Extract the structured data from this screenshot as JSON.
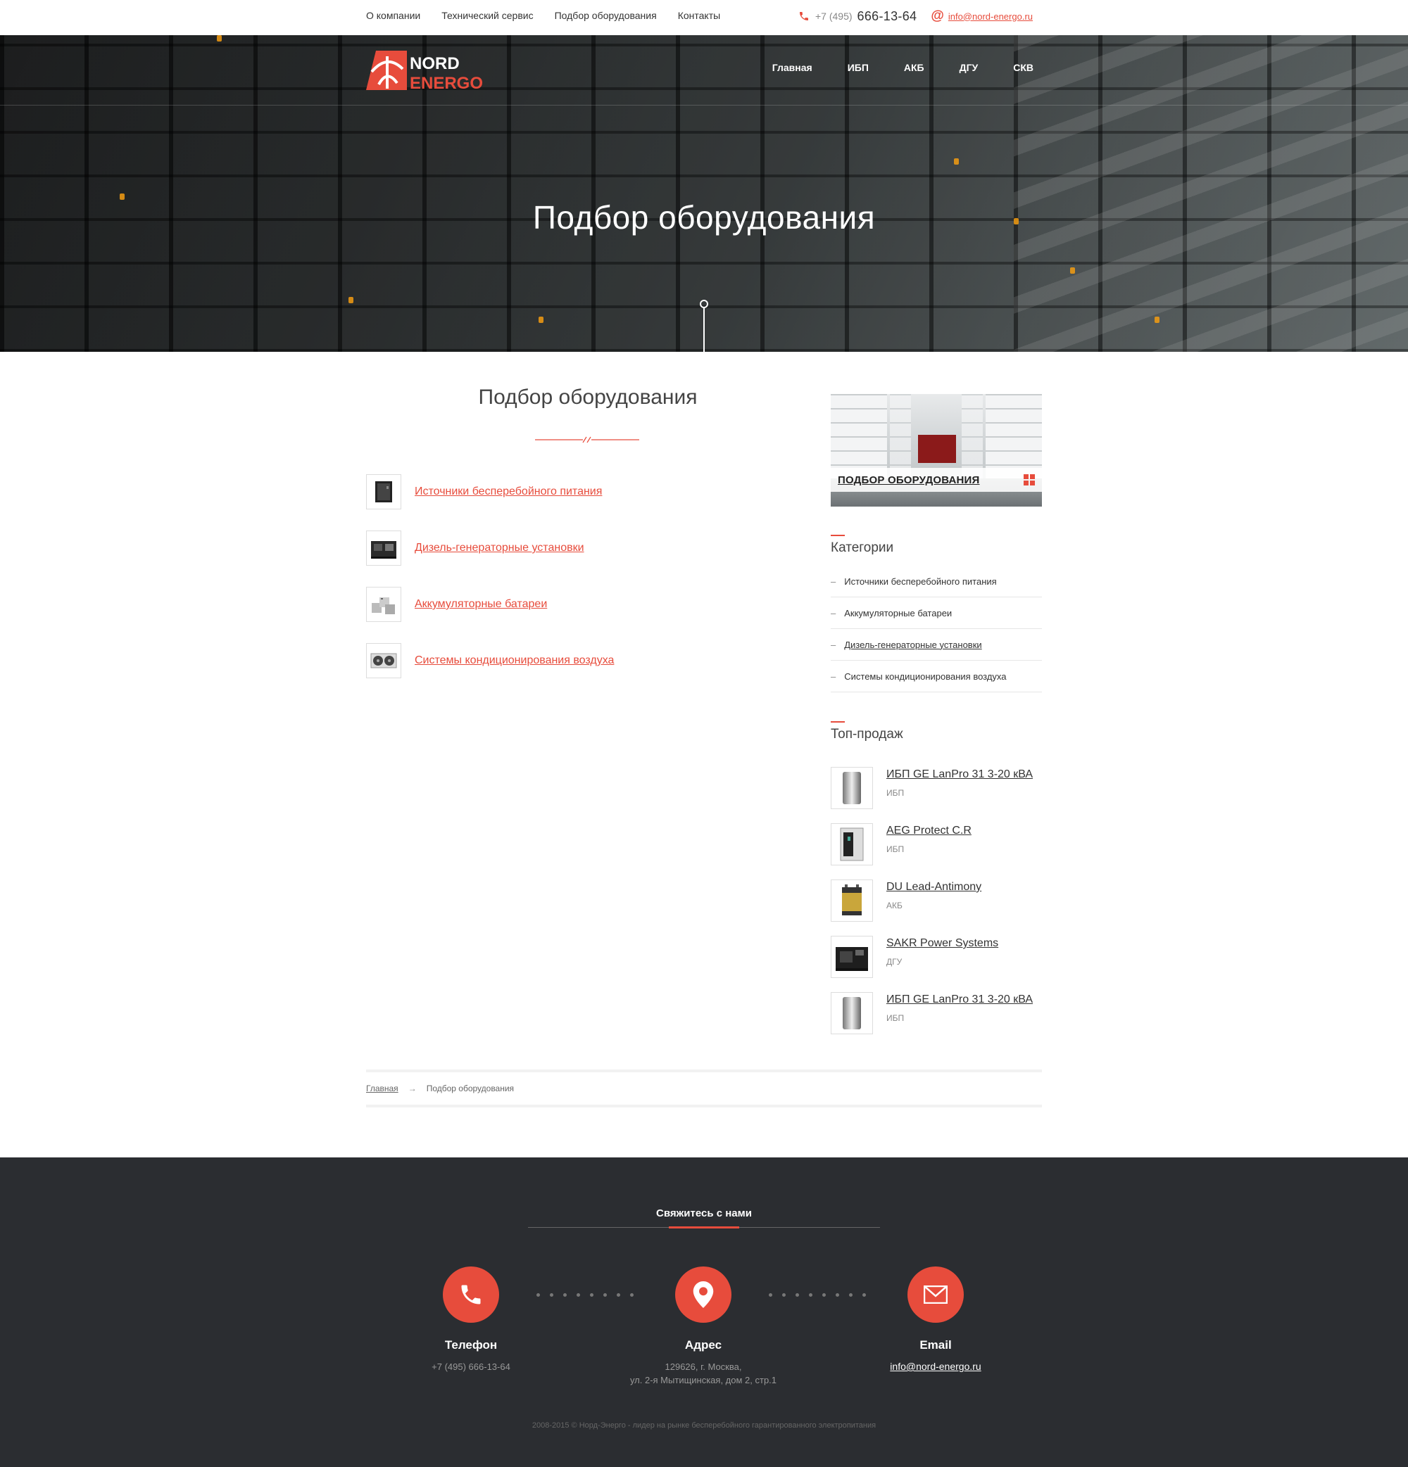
{
  "topbar": {
    "nav": [
      "О компании",
      "Технический сервис",
      "Подбор оборудования",
      "Контакты"
    ],
    "phone_code": "+7 (495)",
    "phone_number": "666-13-64",
    "email": "info@nord-energo.ru"
  },
  "header": {
    "logo_text_top": "NORD",
    "logo_text_bottom": "ENERGO",
    "nav": [
      "Главная",
      "ИБП",
      "АКБ",
      "ДГУ",
      "СКВ"
    ],
    "hero_title": "Подбор оборудования"
  },
  "main": {
    "title": "Подбор оборудования",
    "categories": [
      {
        "label": "Источники бесперебойного питания",
        "icon": "ups-icon"
      },
      {
        "label": "Дизель-генераторные установки",
        "icon": "generator-icon"
      },
      {
        "label": "Аккумуляторные батареи",
        "icon": "battery-icon"
      },
      {
        "label": "Системы кондиционирования воздуха",
        "icon": "air-conditioner-icon"
      }
    ]
  },
  "sidebar": {
    "banner_label": "ПОДБОР ОБОРУДОВАНИЯ",
    "categories_title": "Категории",
    "categories": [
      "Источники бесперебойного питания",
      "Аккумуляторные батареи",
      "Дизель-генераторные установки",
      "Системы кондиционирования воздуха"
    ],
    "top_title": "Топ-продаж",
    "top_items": [
      {
        "name": "ИБП GE LanPro 31 3-20 кВА",
        "category": "ИБП"
      },
      {
        "name": "AEG Protect C.R",
        "category": "ИБП"
      },
      {
        "name": "DU Lead-Antimony",
        "category": "АКБ"
      },
      {
        "name": "SAKR Power Systems",
        "category": "ДГУ"
      },
      {
        "name": "ИБП GE LanPro 31 3-20 кВА",
        "category": "ИБП"
      }
    ]
  },
  "breadcrumb": {
    "home": "Главная",
    "arrow": "→",
    "current": "Подбор оборудования"
  },
  "footer": {
    "title": "Свяжитесь с нами",
    "phone_label": "Телефон",
    "phone_value": "+7 (495) 666-13-64",
    "address_label": "Адрес",
    "address_line1": "129626, г. Москва,",
    "address_line2": "ул. 2-я Мытищинская, дом 2, стр.1",
    "email_label": "Email",
    "email_value": "info@nord-energo.ru",
    "copyright": "2008-2015 ©  Норд-Энерго - лидер на рынке бесперебойного гарантированного электропитания"
  },
  "colors": {
    "accent": "#e74c3c",
    "footer_bg": "#2b2d31"
  }
}
